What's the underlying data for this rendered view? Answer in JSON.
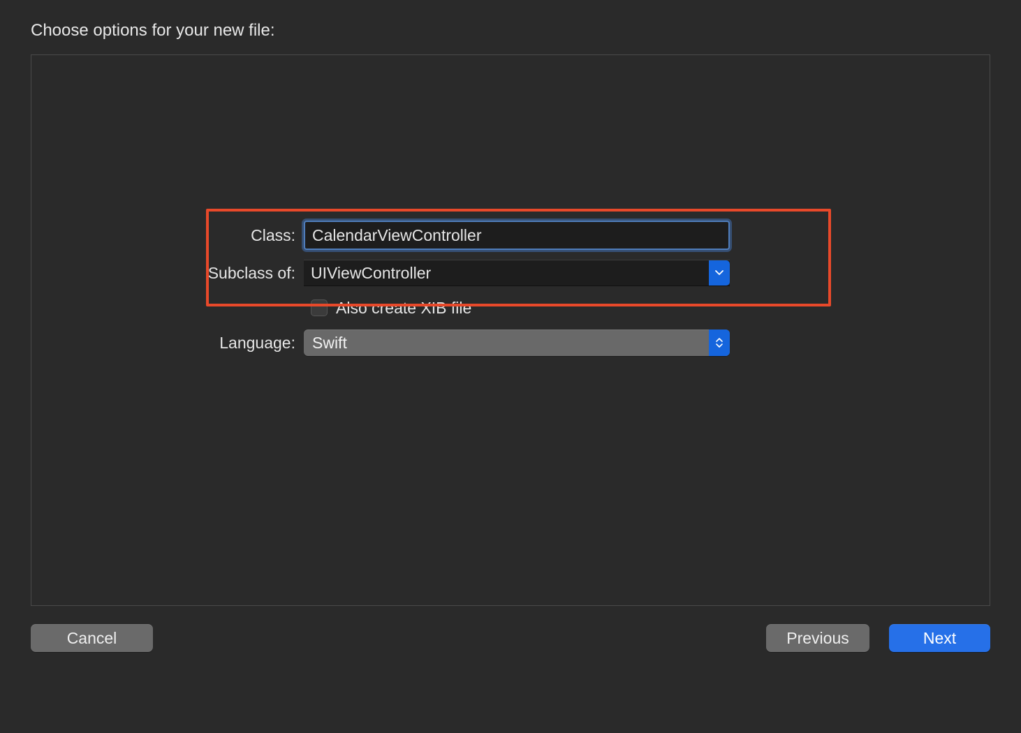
{
  "heading": "Choose options for your new file:",
  "form": {
    "class_label": "Class:",
    "class_value": "CalendarViewController",
    "subclass_label": "Subclass of:",
    "subclass_value": "UIViewController",
    "xib_label": "Also create XIB file",
    "xib_checked": false,
    "language_label": "Language:",
    "language_value": "Swift"
  },
  "buttons": {
    "cancel": "Cancel",
    "previous": "Previous",
    "next": "Next"
  }
}
